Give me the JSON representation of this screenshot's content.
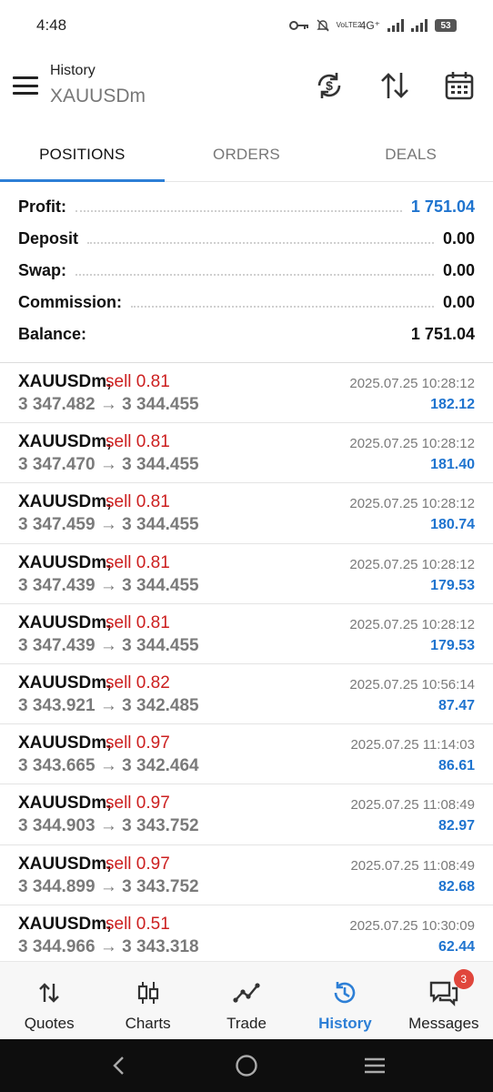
{
  "status_bar": {
    "time": "4:48",
    "network_label": "4G⁺",
    "volte_label": "VoLTE2",
    "battery": "53"
  },
  "header": {
    "title": "History",
    "subtitle": "XAUUSDm",
    "icons": [
      "currency-sync-icon",
      "sort-icon",
      "calendar-icon"
    ]
  },
  "tabs": [
    {
      "label": "POSITIONS",
      "active": true
    },
    {
      "label": "ORDERS",
      "active": false
    },
    {
      "label": "DEALS",
      "active": false
    }
  ],
  "summary": {
    "profit_label": "Profit:",
    "profit_value": "1 751.04",
    "deposit_label": "Deposit",
    "deposit_value": "0.00",
    "swap_label": "Swap:",
    "swap_value": "0.00",
    "commission_label": "Commission:",
    "commission_value": "0.00",
    "balance_label": "Balance:",
    "balance_value": "1 751.04"
  },
  "deals": [
    {
      "symbol": "XAUUSDm,",
      "side": "sell 0.81",
      "open_price": "3 347.482",
      "close_price": "3 344.455",
      "time": "2025.07.25 10:28:12",
      "profit": "182.12"
    },
    {
      "symbol": "XAUUSDm,",
      "side": "sell 0.81",
      "open_price": "3 347.470",
      "close_price": "3 344.455",
      "time": "2025.07.25 10:28:12",
      "profit": "181.40"
    },
    {
      "symbol": "XAUUSDm,",
      "side": "sell 0.81",
      "open_price": "3 347.459",
      "close_price": "3 344.455",
      "time": "2025.07.25 10:28:12",
      "profit": "180.74"
    },
    {
      "symbol": "XAUUSDm,",
      "side": "sell 0.81",
      "open_price": "3 347.439",
      "close_price": "3 344.455",
      "time": "2025.07.25 10:28:12",
      "profit": "179.53"
    },
    {
      "symbol": "XAUUSDm,",
      "side": "sell 0.81",
      "open_price": "3 347.439",
      "close_price": "3 344.455",
      "time": "2025.07.25 10:28:12",
      "profit": "179.53"
    },
    {
      "symbol": "XAUUSDm,",
      "side": "sell 0.82",
      "open_price": "3 343.921",
      "close_price": "3 342.485",
      "time": "2025.07.25 10:56:14",
      "profit": "87.47"
    },
    {
      "symbol": "XAUUSDm,",
      "side": "sell 0.97",
      "open_price": "3 343.665",
      "close_price": "3 342.464",
      "time": "2025.07.25 11:14:03",
      "profit": "86.61"
    },
    {
      "symbol": "XAUUSDm,",
      "side": "sell 0.97",
      "open_price": "3 344.903",
      "close_price": "3 343.752",
      "time": "2025.07.25 11:08:49",
      "profit": "82.97"
    },
    {
      "symbol": "XAUUSDm,",
      "side": "sell 0.97",
      "open_price": "3 344.899",
      "close_price": "3 343.752",
      "time": "2025.07.25 11:08:49",
      "profit": "82.68"
    },
    {
      "symbol": "XAUUSDm,",
      "side": "sell 0.51",
      "open_price": "3 344.966",
      "close_price": "3 343.318",
      "time": "2025.07.25 10:30:09",
      "profit": "62.44"
    }
  ],
  "arrow": "→",
  "bottom_nav": [
    {
      "label": "Quotes",
      "icon": "quotes-icon",
      "active": false
    },
    {
      "label": "Charts",
      "icon": "charts-icon",
      "active": false
    },
    {
      "label": "Trade",
      "icon": "trade-icon",
      "active": false
    },
    {
      "label": "History",
      "icon": "history-icon",
      "active": true
    },
    {
      "label": "Messages",
      "icon": "messages-icon",
      "active": false,
      "badge": "3"
    }
  ],
  "colors": {
    "accent": "#2d7fd6",
    "profit_blue": "#1f74cf",
    "sell_red": "#cc1f1f",
    "badge_red": "#e0463c"
  }
}
